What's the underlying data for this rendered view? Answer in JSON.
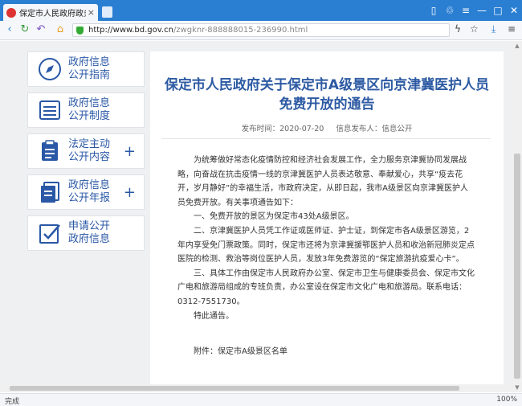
{
  "browser": {
    "tab_title": "保定市人民政府政务公开",
    "tab_close": "×",
    "url_host": "http://www.bd.gov.cn",
    "url_path": "/zwgknr-888888015-236990.html",
    "status_text": "完成",
    "zoom": "100%",
    "accent_color": "#2b7fd3"
  },
  "sidebar": {
    "items": [
      {
        "line1": "政府信息",
        "line2": "公开指南",
        "icon": "compass-icon",
        "expandable": false
      },
      {
        "line1": "政府信息",
        "line2": "公开制度",
        "icon": "list-icon",
        "expandable": false
      },
      {
        "line1": "法定主动",
        "line2": "公开内容",
        "icon": "clipboard-icon",
        "expandable": true
      },
      {
        "line1": "政府信息",
        "line2": "公开年报",
        "icon": "report-icon",
        "expandable": true
      },
      {
        "line1": "申请公开",
        "line2": "政府信息",
        "icon": "edit-icon",
        "expandable": false
      }
    ],
    "plus": "+"
  },
  "article": {
    "title": "保定市人民政府关于保定市A级景区向京津冀医护人员免费开放的通告",
    "publish_time": "发布时间：2020-07-20",
    "publisher": "信息发布人：信息公开",
    "paragraphs": [
      "为统筹做好常态化疫情防控和经济社会发展工作，全力服务京津冀协同发展战略，向奋战在抗击疫情一线的京津冀医护人员表达敬意、奉献爱心，共享“疫去花开，岁月静好”的幸福生活，市政府决定，从即日起，我市A级景区向京津冀医护人员免费开放。有关事项通告如下：",
      "一、免费开放的景区为保定市43处A级景区。",
      "二、京津冀医护人员凭工作证或医师证、护士证，到保定市各A级景区游览，2年内享受免门票政策。同时，保定市还将为京津冀援鄂医护人员和收治新冠肺炎定点医院的检测、救治等岗位医护人员，发放3年免费游览的“保定旅游抗疫爱心卡”。",
      "三、具体工作由保定市人民政府办公室、保定市卫生与健康委员会、保定市文化广电和旅游局组成的专班负责，办公室设在保定市文化广电和旅游局。联系电话：0312-7551730。",
      "特此通告。"
    ],
    "attachment": "附件：保定市A级景区名单"
  }
}
